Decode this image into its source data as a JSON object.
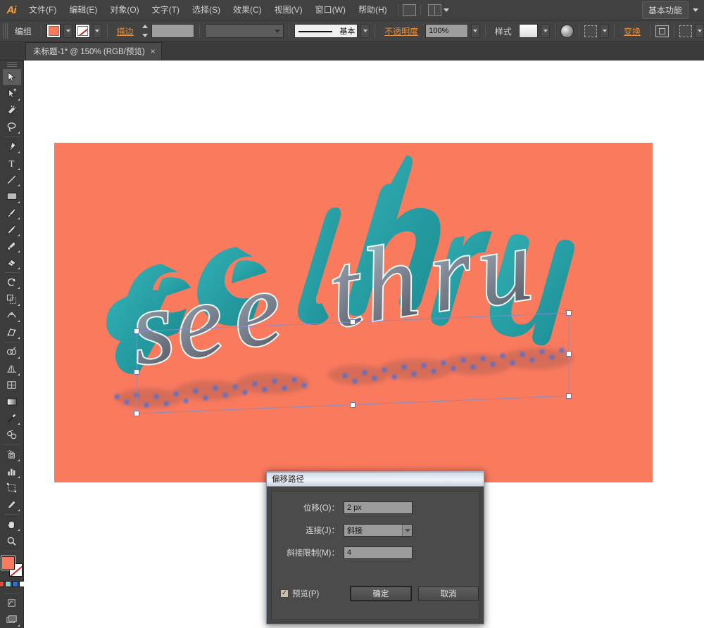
{
  "app": {
    "name": "Ai",
    "logo_text": "Ai"
  },
  "menubar": {
    "items": [
      {
        "label": "文件(F)"
      },
      {
        "label": "编辑(E)"
      },
      {
        "label": "对象(O)"
      },
      {
        "label": "文字(T)"
      },
      {
        "label": "选择(S)"
      },
      {
        "label": "效果(C)"
      },
      {
        "label": "视图(V)"
      },
      {
        "label": "窗口(W)"
      },
      {
        "label": "帮助(H)"
      }
    ],
    "bridge_icon": "bridge-icon",
    "arrange_icon": "arrange-documents-icon",
    "workspace": "基本功能"
  },
  "controlbar": {
    "object_label": "编组",
    "fill_color": "#fa7a5e",
    "stroke_label": "描边",
    "stroke_weight": "",
    "stroke_profile_label": "基本",
    "opacity_label": "不透明度",
    "opacity_value": "100%",
    "style_label": "样式",
    "transform_label": "变换",
    "align_icon": "align-icon",
    "document_setup_icon": "document-setup-icon"
  },
  "tabbar": {
    "document_title": "未标题-1* @ 150% (RGB/预览)",
    "close_glyph": "×"
  },
  "toolbar": {
    "tools": [
      {
        "name": "selection-tool",
        "active": true
      },
      {
        "name": "direct-selection-tool",
        "active": false
      },
      {
        "name": "magic-wand-tool",
        "active": false
      },
      {
        "name": "lasso-tool",
        "active": false
      },
      {
        "name": "pen-tool",
        "active": false
      },
      {
        "name": "type-tool",
        "active": false
      },
      {
        "name": "line-segment-tool",
        "active": false
      },
      {
        "name": "rectangle-tool",
        "active": false
      },
      {
        "name": "paintbrush-tool",
        "active": false
      },
      {
        "name": "pencil-tool",
        "active": false
      },
      {
        "name": "blob-brush-tool",
        "active": false
      },
      {
        "name": "eraser-tool",
        "active": false
      },
      {
        "name": "rotate-tool",
        "active": false
      },
      {
        "name": "scale-tool",
        "active": false
      },
      {
        "name": "width-tool",
        "active": false
      },
      {
        "name": "free-transform-tool",
        "active": false
      },
      {
        "name": "shape-builder-tool",
        "active": false
      },
      {
        "name": "perspective-grid-tool",
        "active": false
      },
      {
        "name": "mesh-tool",
        "active": false
      },
      {
        "name": "gradient-tool",
        "active": false
      },
      {
        "name": "eyedropper-tool",
        "active": false
      },
      {
        "name": "blend-tool",
        "active": false
      },
      {
        "name": "symbol-sprayer-tool",
        "active": false
      },
      {
        "name": "column-graph-tool",
        "active": false
      },
      {
        "name": "artboard-tool",
        "active": false
      },
      {
        "name": "slice-tool",
        "active": false
      },
      {
        "name": "hand-tool",
        "active": false
      },
      {
        "name": "zoom-tool",
        "active": false
      }
    ],
    "fill_color": "#fa7a5e",
    "stroke_color": "#ffffff",
    "mini_swatches": [
      "#e04a3a",
      "#7fd2d6",
      "#2f6fd0",
      "#ffffff"
    ]
  },
  "artwork": {
    "background_color": "#fa7a5e",
    "text": "see thru",
    "face_color": "#18a0a8",
    "extrude_color": "#1f8e96",
    "outline_color": "#eafaf8",
    "shadow_color": "#cf6a56",
    "anchor_color": "#4d6fd4",
    "selection_color": "#7a8fd0",
    "zoom": "150%"
  },
  "dialog": {
    "title": "偏移路径",
    "fields": [
      {
        "label": "位移(O)：",
        "value": "2 px",
        "type": "input",
        "name": "offset-field"
      },
      {
        "label": "连接(J)：",
        "value": "斜接",
        "type": "select",
        "name": "join-select"
      },
      {
        "label": "斜接限制(M)：",
        "value": "4",
        "type": "input",
        "name": "miter-limit-field"
      }
    ],
    "preview_label": "预览(P)",
    "preview_checked": true,
    "check_glyph": "✓",
    "ok_label": "确定",
    "cancel_label": "取消"
  }
}
